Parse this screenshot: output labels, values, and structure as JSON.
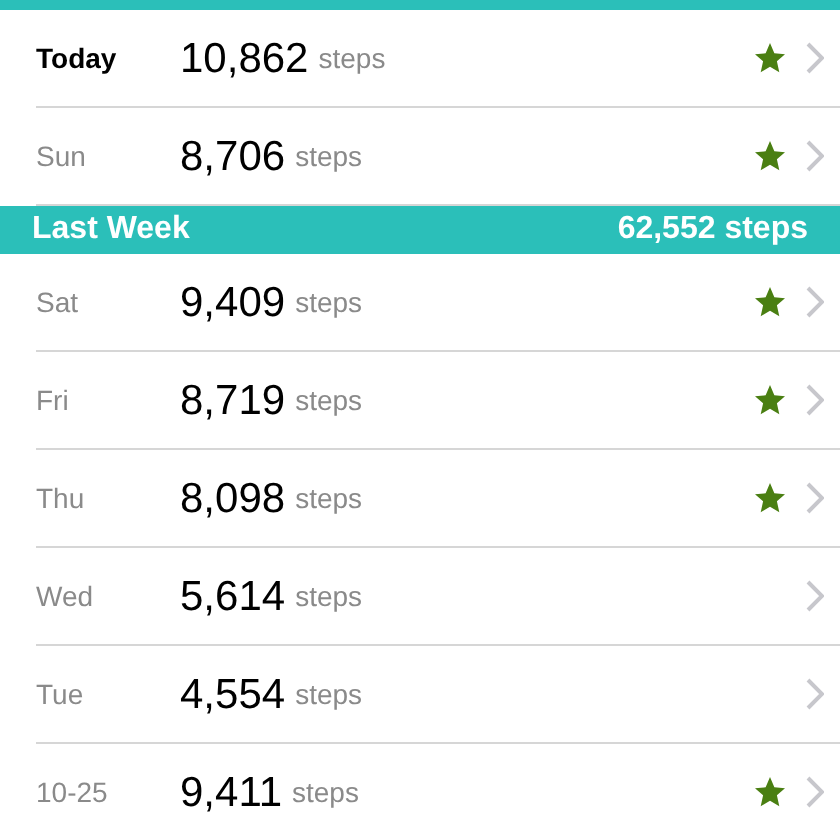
{
  "sections": [
    {
      "kind": "plain",
      "rows": [
        {
          "day": "Today",
          "current": true,
          "count": "10,862",
          "unit": "steps",
          "goal_met": true
        },
        {
          "day": "Sun",
          "current": false,
          "count": "8,706",
          "unit": "steps",
          "goal_met": true
        }
      ]
    },
    {
      "kind": "week",
      "title": "Last Week",
      "total": "62,552 steps",
      "rows": [
        {
          "day": "Sat",
          "current": false,
          "count": "9,409",
          "unit": "steps",
          "goal_met": true
        },
        {
          "day": "Fri",
          "current": false,
          "count": "8,719",
          "unit": "steps",
          "goal_met": true
        },
        {
          "day": "Thu",
          "current": false,
          "count": "8,098",
          "unit": "steps",
          "goal_met": true
        },
        {
          "day": "Wed",
          "current": false,
          "count": "5,614",
          "unit": "steps",
          "goal_met": false
        },
        {
          "day": "Tue",
          "current": false,
          "count": "4,554",
          "unit": "steps",
          "goal_met": false
        },
        {
          "day": "10-25",
          "current": false,
          "count": "9,411",
          "unit": "steps",
          "goal_met": true
        }
      ]
    }
  ]
}
